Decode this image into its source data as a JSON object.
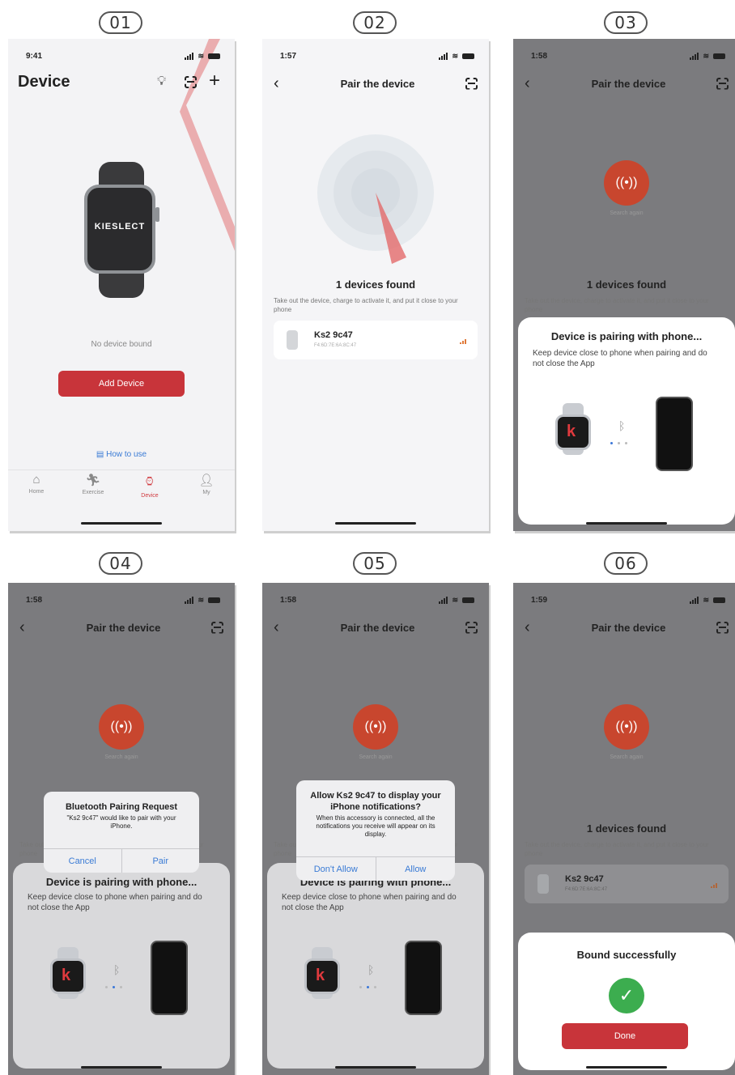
{
  "steps": [
    "01",
    "02",
    "03",
    "04",
    "05",
    "06"
  ],
  "screen1": {
    "time": "9:41",
    "title": "Device",
    "watch_brand": "KIESLECT",
    "empty_text": "No device bound",
    "add_button": "Add Device",
    "how_to_use": "How to use",
    "tabs": [
      "Home",
      "Exercise",
      "Device",
      "My"
    ]
  },
  "pair": {
    "title": "Pair the device",
    "found": "1 devices found",
    "hint": "Take out the device, charge to activate it, and put it close to your phone",
    "search_again": "Search again",
    "device_name": "Ks2 9c47",
    "device_mac": "F4:6D:7E:6A:8C:47"
  },
  "times": {
    "s2": "1:57",
    "s3": "1:58",
    "s4": "1:58",
    "s5": "1:58",
    "s6": "1:59"
  },
  "pairing_sheet": {
    "title": "Device is pairing with phone...",
    "desc": "Keep device close to phone when pairing and do not close the App"
  },
  "bt_alert": {
    "title": "Bluetooth Pairing Request",
    "msg": "\"Ks2 9c47\" would like to pair with your iPhone.",
    "cancel": "Cancel",
    "pair": "Pair"
  },
  "notif_alert": {
    "title": "Allow Ks2 9c47 to display your iPhone notifications?",
    "msg": "When this accessory is connected, all the notifications you receive will appear on its display.",
    "deny": "Don't Allow",
    "allow": "Allow"
  },
  "success": {
    "title": "Bound successfully",
    "done": "Done"
  },
  "icons": [
    "back-icon",
    "scan-icon",
    "plus-icon",
    "bulb-icon",
    "signal-icon",
    "wifi-icon",
    "battery-icon",
    "bluetooth-icon",
    "check-icon",
    "broadcast-icon",
    "watch-icon",
    "book-icon",
    "home-icon",
    "exercise-icon",
    "device-icon",
    "user-icon"
  ],
  "colors": {
    "accent": "#c8343a",
    "success": "#3cad4f",
    "link": "#3a7bd5"
  }
}
